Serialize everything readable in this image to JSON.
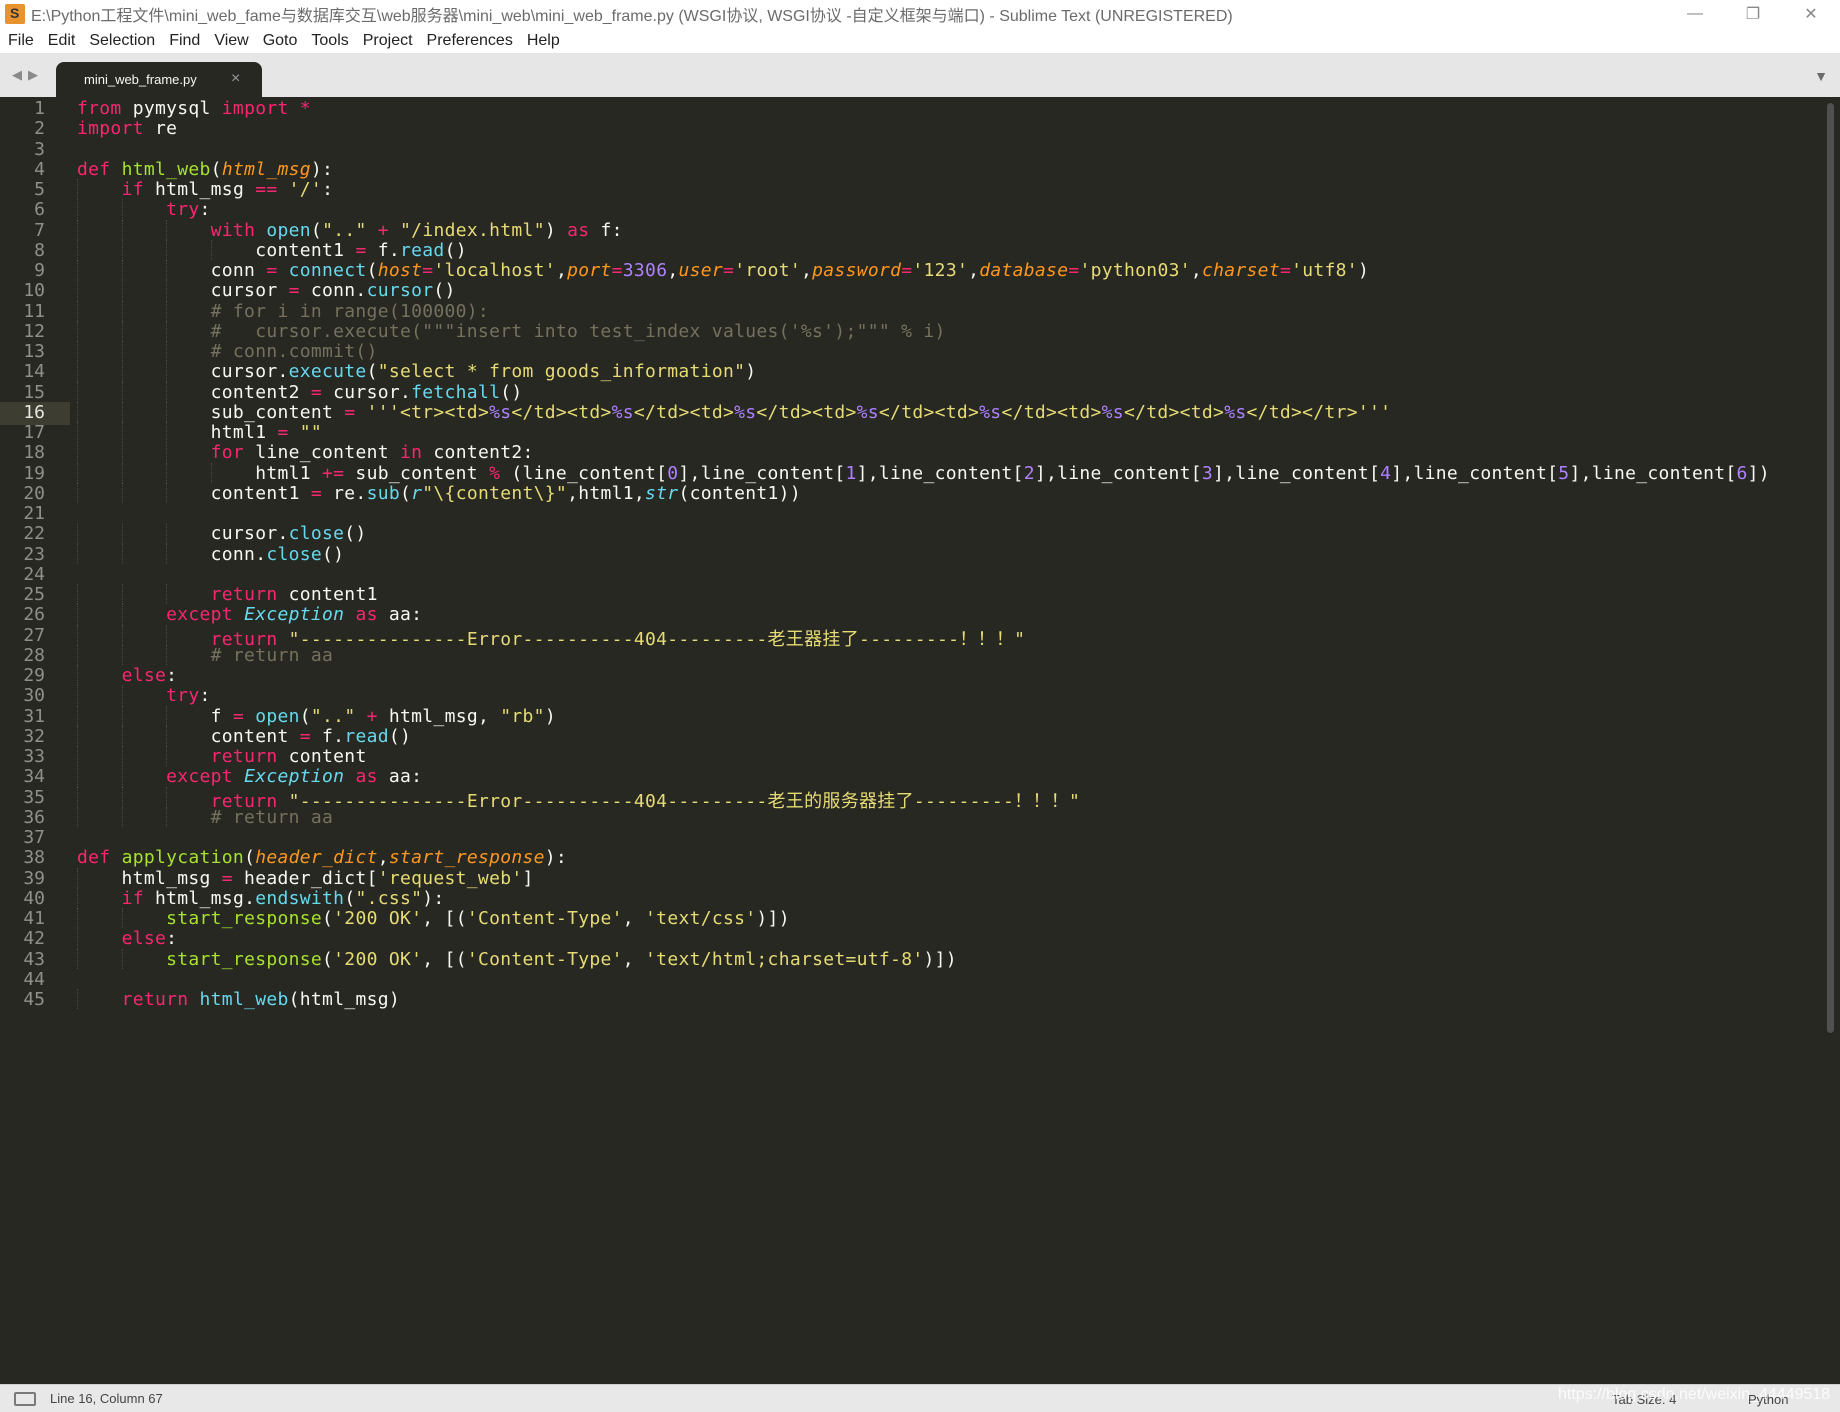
{
  "window": {
    "title": "E:\\Python工程文件\\mini_web_fame与数据库交互\\web服务器\\mini_web\\mini_web_frame.py (WSGI协议, WSGI协议 -自定义框架与端口) - Sublime Text (UNREGISTERED)",
    "minimize": "—",
    "restore": "❐",
    "close": "✕"
  },
  "menu": [
    "File",
    "Edit",
    "Selection",
    "Find",
    "View",
    "Goto",
    "Tools",
    "Project",
    "Preferences",
    "Help"
  ],
  "tabs": {
    "back": "◀",
    "forward": "▶",
    "active_tab": "mini_web_frame.py",
    "close": "×",
    "dropdown": "▼"
  },
  "editor": {
    "active_line": 16,
    "lines": [
      "from pymysql import *",
      "import re",
      "",
      "def html_web(html_msg):",
      "    if html_msg == '/':",
      "        try:",
      "            with open(\"..\" + \"/index.html\") as f:",
      "                content1 = f.read()",
      "            conn = connect(host='localhost',port=3306,user='root',password='123',database='python03',charset='utf8')",
      "            cursor = conn.cursor()",
      "            # for i in range(100000):",
      "            #   cursor.execute(\"\"\"insert into test_index values('%s');\"\"\" % i)",
      "            # conn.commit()",
      "            cursor.execute(\"select * from goods_information\")",
      "            content2 = cursor.fetchall()",
      "            sub_content = '''<tr><td>%s</td><td>%s</td><td>%s</td><td>%s</td><td>%s</td><td>%s</td><td>%s</td></tr>'''",
      "            html1 = \"\"",
      "            for line_content in content2:",
      "                html1 += sub_content % (line_content[0],line_content[1],line_content[2],line_content[3],line_content[4],line_content[5],line_content[6])",
      "            content1 = re.sub(r\"\\{content\\}\",html1,str(content1))",
      "",
      "            cursor.close()",
      "            conn.close()",
      "",
      "            return content1",
      "        except Exception as aa:",
      "            return \"---------------Error----------404---------老王器挂了---------！！！\"",
      "            # return aa",
      "    else:",
      "        try:",
      "            f = open(\"..\" + html_msg, \"rb\")",
      "            content = f.read()",
      "            return content",
      "        except Exception as aa:",
      "            return \"---------------Error----------404---------老王的服务器挂了---------！！！\"",
      "            # return aa",
      "",
      "def applycation(header_dict,start_response):",
      "    html_msg = header_dict['request_web']",
      "    if html_msg.endswith(\".css\"):",
      "        start_response('200 OK', [('Content-Type', 'text/css')])",
      "    else:",
      "        start_response('200 OK', [('Content-Type', 'text/html;charset=utf-8')])",
      "",
      "    return html_web(html_msg)"
    ]
  },
  "status": {
    "position": "Line 16, Column 67",
    "tab_size": "Tab Size: 4",
    "syntax": "Python",
    "watermark": "https://blog.csdn.net/weixin_44449518"
  },
  "colors": {
    "background": "#272822",
    "keyword": "#f92672",
    "string": "#e6db74",
    "function": "#a6e22e",
    "builtin": "#66d9ef",
    "number": "#ae81ff",
    "parameter": "#fd971f",
    "comment": "#75715e"
  }
}
